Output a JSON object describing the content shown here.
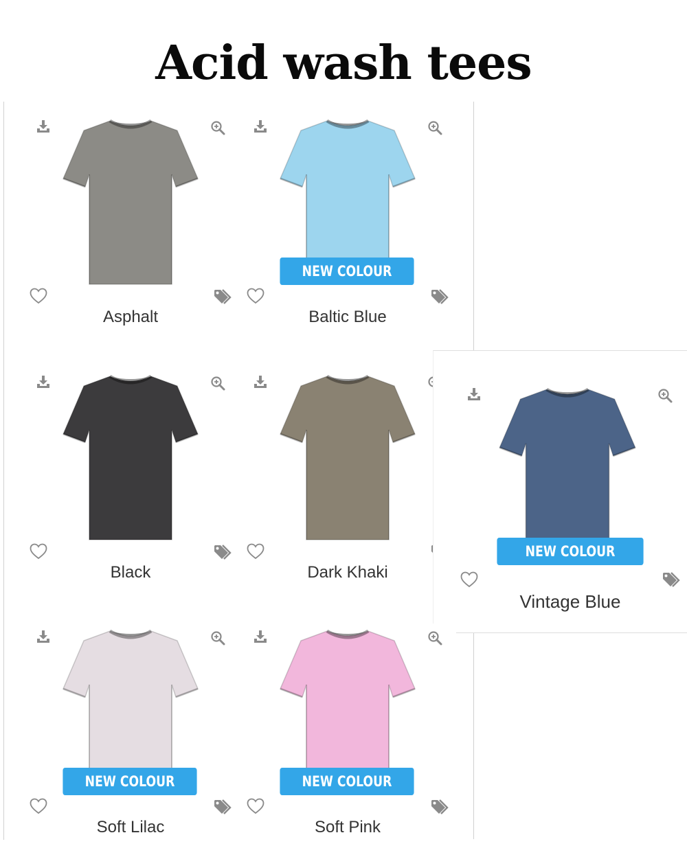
{
  "page": {
    "title": "Acid wash tees"
  },
  "products": [
    {
      "name": "Asphalt",
      "color": "#8c8b86",
      "new": false,
      "badge": ""
    },
    {
      "name": "Baltic Blue",
      "color": "#9dd5ee",
      "new": true,
      "badge": "NEW COLOUR"
    },
    {
      "name": "Black",
      "color": "#3c3b3d",
      "new": false,
      "badge": ""
    },
    {
      "name": "Dark Khaki",
      "color": "#8a8272",
      "new": false,
      "badge": ""
    },
    {
      "name": "Vintage Blue",
      "color": "#4c6488",
      "new": true,
      "badge": "NEW COLOUR"
    },
    {
      "name": "Soft Lilac",
      "color": "#e5dde2",
      "new": true,
      "badge": "NEW COLOUR"
    },
    {
      "name": "Soft Pink",
      "color": "#f2b7dc",
      "new": true,
      "badge": "NEW COLOUR"
    }
  ],
  "icons": {
    "download": "download-icon",
    "zoom": "zoom-in-icon",
    "favourite": "heart-icon",
    "tags": "tags-icon"
  }
}
